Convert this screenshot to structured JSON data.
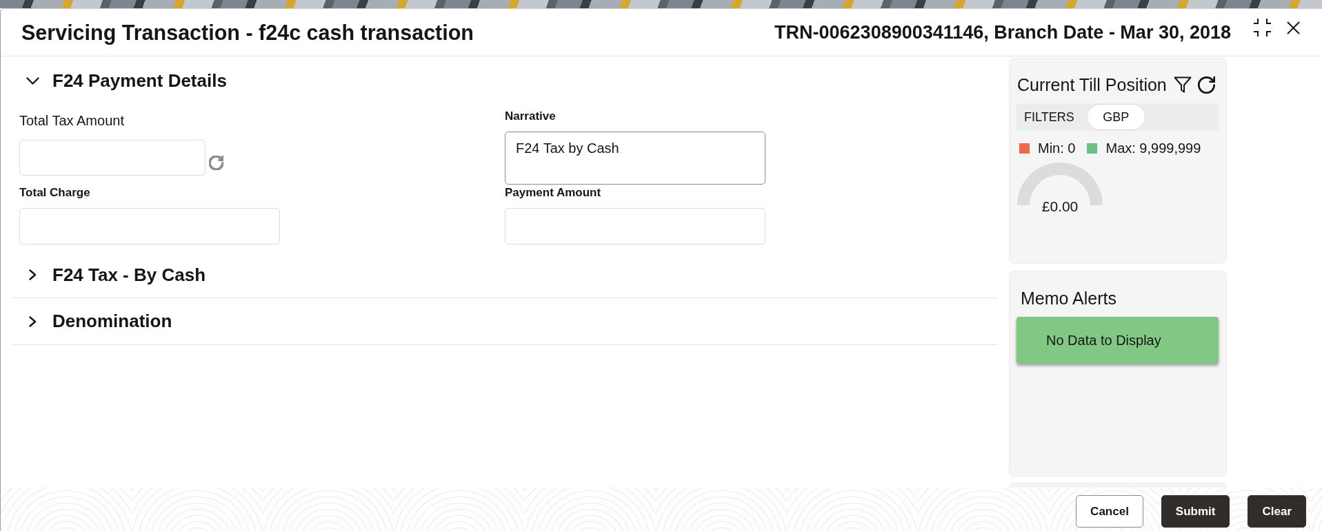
{
  "window": {
    "title": "Servicing Transaction - f24c cash transaction",
    "reference": "TRN-0062308900341146, Branch Date - Mar 30, 2018"
  },
  "sections": [
    {
      "title": "F24 Payment Details",
      "expanded": true,
      "fields": [
        {
          "label": "Total Tax Amount",
          "kind": "refresh"
        },
        {
          "label": "Narrative",
          "kind": "textarea",
          "value": "F24 Tax by Cash"
        },
        {
          "label": "Total Charge",
          "kind": "text"
        },
        {
          "label": "Payment Amount",
          "kind": "text"
        }
      ]
    },
    {
      "title": "F24 Tax - By Cash",
      "expanded": false
    },
    {
      "title": "Denomination",
      "expanded": false
    }
  ],
  "till_position": {
    "title": "Current Till Position",
    "filters_label": "FILTERS",
    "filters": [
      {
        "label": "GBP",
        "selected": true
      }
    ],
    "legend": [
      {
        "label": "Min: 0",
        "color": "#ee6a4b"
      },
      {
        "label": "Max: 9,999,999",
        "color": "#6abf83"
      }
    ],
    "gauge": {
      "reading": "£0.00"
    }
  },
  "memo_alerts": {
    "title": "Memo Alerts",
    "message": "No Data to Display"
  },
  "buttons": [
    {
      "label": "Cancel",
      "kind": "secondary"
    },
    {
      "label": "Submit",
      "kind": "primary"
    },
    {
      "label": "Clear",
      "kind": "primary"
    }
  ]
}
